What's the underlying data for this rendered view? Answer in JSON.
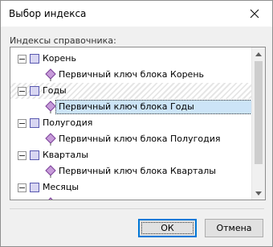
{
  "dialog": {
    "title": "Выбор индекса",
    "close_icon": "close-icon"
  },
  "indexes_label": "Индексы справочника:",
  "tree": {
    "nodes": [
      {
        "label": "Корень",
        "child": "Первичный ключ блока Корень"
      },
      {
        "label": "Годы",
        "child": "Первичный ключ блока Годы",
        "selected": true
      },
      {
        "label": "Полугодия",
        "child": "Первичный ключ блока Полугодия"
      },
      {
        "label": "Кварталы",
        "child": "Первичный ключ блока Кварталы"
      },
      {
        "label": "Месяцы"
      }
    ]
  },
  "buttons": {
    "ok": "ОК",
    "cancel": "Отмена"
  },
  "colors": {
    "selection": "#cce4f7",
    "key_icon": "#8a4ca8",
    "node_box": "#d8d6f2"
  }
}
